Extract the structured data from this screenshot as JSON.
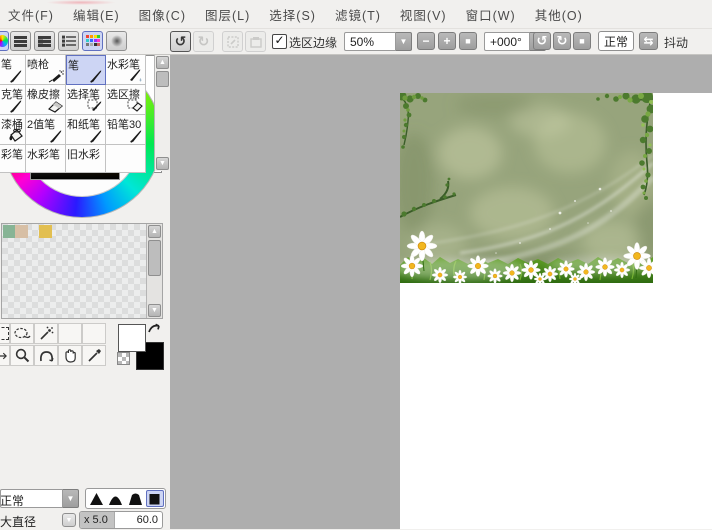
{
  "menu": {
    "items": [
      "文件(F)",
      "编辑(E)",
      "图像(C)",
      "图层(L)",
      "选择(S)",
      "滤镜(T)",
      "视图(V)",
      "窗口(W)",
      "其他(O)"
    ]
  },
  "toolbar": {
    "selection_edge_label": "选区边缘",
    "zoom_value": "50%",
    "angle_value": "+000°",
    "view_mode_label": "正常",
    "dither_label": "抖动"
  },
  "icons": {
    "undo": "↺",
    "redo": "↻",
    "zoom_out": "−",
    "zoom_in": "+",
    "zoom_reset": "■",
    "rotate_ccw": "↺",
    "rotate_cw": "↻",
    "rotate_reset": "■",
    "flip": "⇆",
    "dropdown": "▼",
    "scroll_up": "▲",
    "scroll_down": "▼",
    "checkbox_check": "✓",
    "tool_names": [
      "marquee",
      "lasso",
      "magic-wand",
      "move",
      "zoom",
      "rotate-view",
      "hand",
      "eyedropper"
    ]
  },
  "swatches": {
    "colors": [
      "#87b495",
      "#d7bfa5",
      "",
      "#e2bf51"
    ]
  },
  "brush_grid": {
    "rows": [
      {
        "cells": [
          {
            "label": "笔",
            "icon": "pen"
          },
          {
            "label": "喷枪",
            "icon": "airbrush"
          },
          {
            "label": "笔",
            "icon": "pen",
            "selected": true
          },
          {
            "label": "水彩笔",
            "icon": "water"
          }
        ]
      },
      {
        "cells": [
          {
            "label": "克笔",
            "icon": "pen"
          },
          {
            "label": "橡皮擦",
            "icon": "eraser"
          },
          {
            "label": "选择笔",
            "icon": "selpen"
          },
          {
            "label": "选区擦",
            "icon": "seleraser"
          }
        ]
      },
      {
        "cells": [
          {
            "label": "漆桶",
            "icon": "bucket"
          },
          {
            "label": "2值笔",
            "icon": "pen"
          },
          {
            "label": "和纸笔",
            "icon": "pen"
          },
          {
            "label": "铅笔30",
            "icon": "pen"
          }
        ]
      },
      {
        "cells": [
          {
            "label": "彩笔",
            "icon": "none"
          },
          {
            "label": "水彩笔",
            "icon": "none"
          },
          {
            "label": "旧水彩",
            "icon": "none"
          },
          {
            "label": "",
            "icon": "none"
          }
        ]
      }
    ]
  },
  "blend": {
    "value": "正常"
  },
  "size": {
    "label": "大直径",
    "multiplier": "x 5.0",
    "value": "60.0"
  },
  "colors": {
    "workspace": "#aeaeae",
    "panel": "#f1f0ee",
    "selection_bg": "#cdd5f4",
    "selection_border": "#6070c0",
    "picked_hue": "#d98e00",
    "foreground": "#ffffff",
    "background": "#000000"
  }
}
